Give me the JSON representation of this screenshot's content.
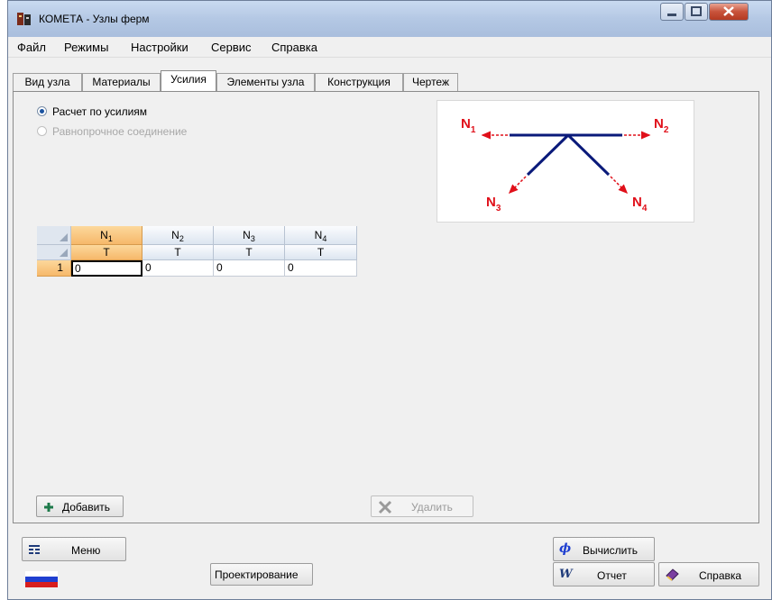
{
  "window": {
    "title": "КОМЕТА - Узлы ферм"
  },
  "menu": [
    "Файл",
    "Режимы",
    "Настройки",
    "Сервис",
    "Справка"
  ],
  "tabs": [
    "Вид узла",
    "Материалы",
    "Усилия",
    "Элементы узла",
    "Конструкция",
    "Чертеж"
  ],
  "active_tab": "Усилия",
  "options": {
    "by_forces": "Расчет по усилиям",
    "equal_strength": "Равнопрочное соединение"
  },
  "diagram": {
    "labels": [
      "N",
      "N",
      "N",
      "N"
    ],
    "subs": [
      "1",
      "2",
      "3",
      "4"
    ]
  },
  "table": {
    "headers": [
      {
        "n": "N",
        "sub": "1"
      },
      {
        "n": "N",
        "sub": "2"
      },
      {
        "n": "N",
        "sub": "3"
      },
      {
        "n": "N",
        "sub": "4"
      }
    ],
    "units": [
      "Т",
      "Т",
      "Т",
      "Т"
    ],
    "row_number": "1",
    "values": [
      "0",
      "0",
      "0",
      "0"
    ]
  },
  "buttons": {
    "add": "Добавить",
    "delete": "Удалить",
    "menu": "Меню",
    "design": "Проектирование",
    "calculate": "Вычислить",
    "report": "Отчет",
    "help": "Справка"
  },
  "colors": {
    "arrow": "#e0101a",
    "member": "#0a1a7a",
    "selected_header": "#f6b86a"
  }
}
